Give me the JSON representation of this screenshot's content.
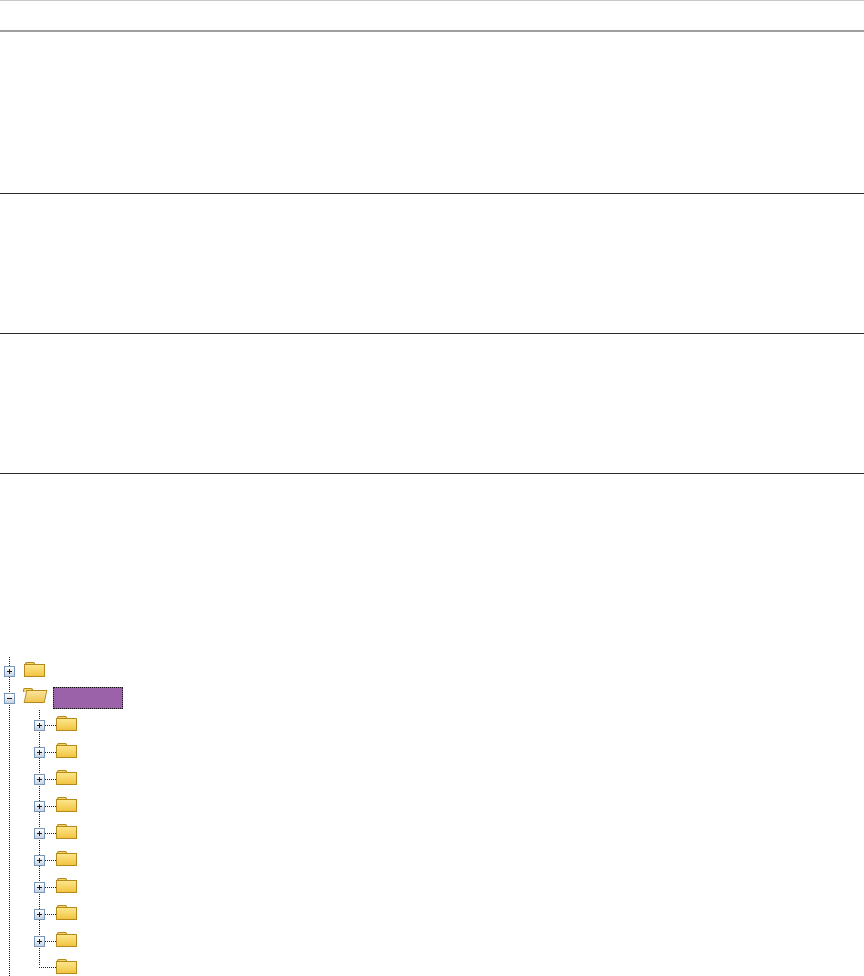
{
  "header": {
    "title": ""
  },
  "tree": {
    "selected_label": "",
    "nodes": [
      {
        "icon": "folder-closed-icon",
        "expanded": false,
        "label": ""
      },
      {
        "icon": "folder-open-icon",
        "expanded": true,
        "label": ""
      },
      {
        "icon": "folder-closed-icon",
        "expanded": false,
        "label": ""
      },
      {
        "icon": "folder-closed-icon",
        "expanded": false,
        "label": ""
      },
      {
        "icon": "folder-closed-icon",
        "expanded": false,
        "label": ""
      },
      {
        "icon": "folder-closed-icon",
        "expanded": false,
        "label": ""
      },
      {
        "icon": "folder-closed-icon",
        "expanded": false,
        "label": ""
      },
      {
        "icon": "folder-closed-icon",
        "expanded": false,
        "label": ""
      },
      {
        "icon": "folder-closed-icon",
        "expanded": false,
        "label": ""
      },
      {
        "icon": "folder-closed-icon",
        "expanded": false,
        "label": ""
      },
      {
        "icon": "folder-closed-icon",
        "expanded": false,
        "label": ""
      },
      {
        "icon": "folder-closed-icon",
        "expanded": false,
        "label": ""
      }
    ]
  },
  "colors": {
    "selection": "#9c62a9",
    "folder": "#f2c441",
    "expander_border": "#7b97b8"
  }
}
